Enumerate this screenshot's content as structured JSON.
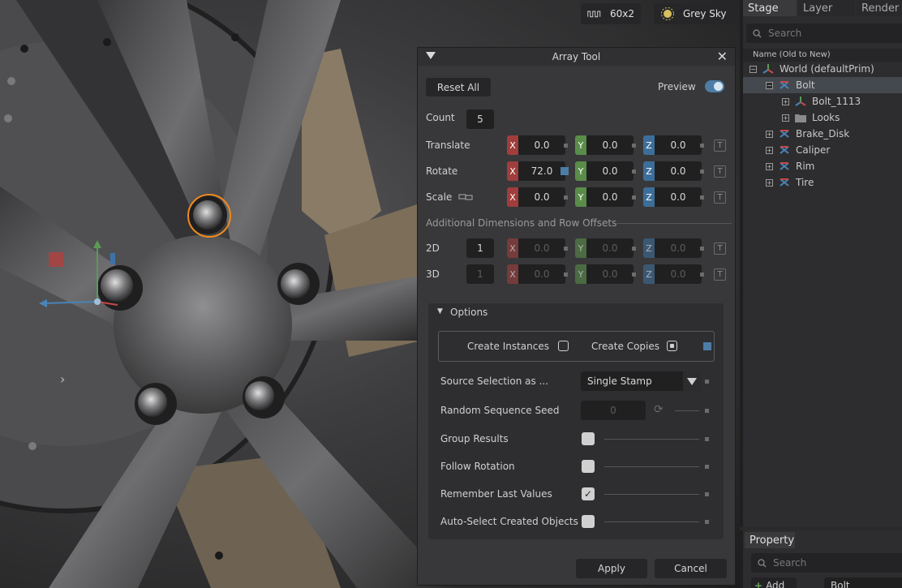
{
  "viewport": {
    "fps_label": "60x2",
    "environment_label": "Grey Sky"
  },
  "dialog": {
    "title": "Array Tool",
    "reset_label": "Reset All",
    "preview_label": "Preview",
    "preview_on": true,
    "count_label": "Count",
    "count_value": "5",
    "rows": {
      "translate": {
        "label": "Translate",
        "x": "0.0",
        "y": "0.0",
        "z": "0.0"
      },
      "rotate": {
        "label": "Rotate",
        "x": "72.0",
        "y": "0.0",
        "z": "0.0"
      },
      "scale": {
        "label": "Scale",
        "x": "0.0",
        "y": "0.0",
        "z": "0.0"
      }
    },
    "axis": {
      "x": "X",
      "y": "Y",
      "z": "Z"
    },
    "additional_header": "Additional Dimensions and Row Offsets",
    "dim2": {
      "label": "2D",
      "count": "1",
      "x": "0.0",
      "y": "0.0",
      "z": "0.0"
    },
    "dim3": {
      "label": "3D",
      "count": "1",
      "x": "0.0",
      "y": "0.0",
      "z": "0.0"
    },
    "options": {
      "header": "Options",
      "create_instances_label": "Create Instances",
      "create_instances_checked": false,
      "create_copies_label": "Create Copies",
      "create_copies_checked": true,
      "source_selection_label": "Source Selection as ...",
      "source_selection_value": "Single Stamp",
      "seed_label": "Random Sequence Seed",
      "seed_value": "0",
      "group_results_label": "Group Results",
      "group_results_checked": false,
      "follow_rotation_label": "Follow Rotation",
      "follow_rotation_checked": false,
      "remember_label": "Remember Last Values",
      "remember_checked": true,
      "auto_select_label": "Auto-Select Created Objects",
      "auto_select_checked": false
    },
    "apply_label": "Apply",
    "cancel_label": "Cancel"
  },
  "stage": {
    "tabs": [
      "Stage",
      "Layer",
      "Render"
    ],
    "search_placeholder": "Search",
    "column_header": "Name (Old to New)",
    "tree": [
      {
        "label": "World (defaultPrim)",
        "expander": "−",
        "selected": false
      },
      {
        "label": "Bolt",
        "expander": "−",
        "selected": true
      },
      {
        "label": "Bolt_1113",
        "expander": "+",
        "selected": false
      },
      {
        "label": "Looks",
        "expander": "+",
        "selected": false
      },
      {
        "label": "Brake_Disk",
        "expander": "+",
        "selected": false
      },
      {
        "label": "Caliper",
        "expander": "+",
        "selected": false
      },
      {
        "label": "Rim",
        "expander": "+",
        "selected": false
      },
      {
        "label": "Tire",
        "expander": "+",
        "selected": false
      }
    ]
  },
  "property": {
    "tab_label": "Property",
    "search_placeholder": "Search",
    "add_label": "Add",
    "name_value": "Bolt"
  }
}
